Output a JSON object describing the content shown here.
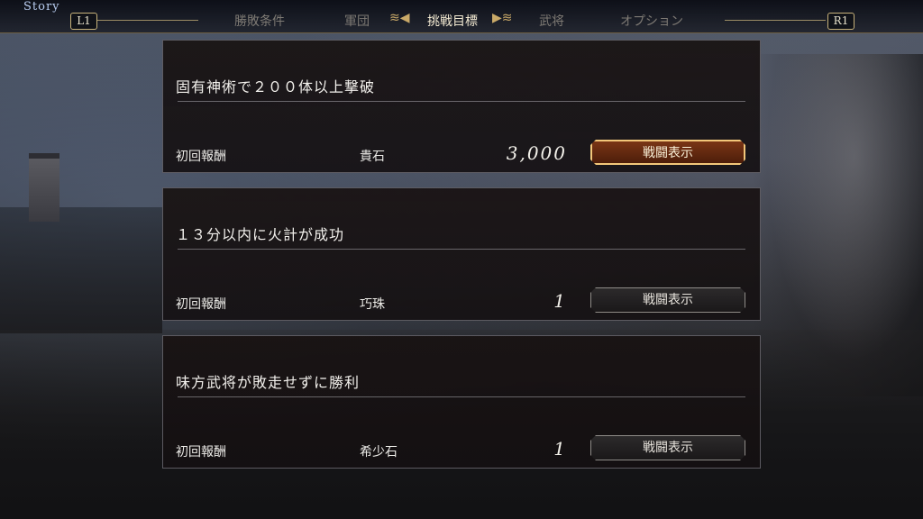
{
  "header": {
    "story_label": "Story",
    "left_bumper": "L1",
    "right_bumper": "R1",
    "tabs": [
      {
        "label": "勝敗条件",
        "active": false
      },
      {
        "label": "軍団",
        "active": false
      },
      {
        "label": "挑戦目標",
        "active": true
      },
      {
        "label": "武将",
        "active": false
      },
      {
        "label": "オプション",
        "active": false
      }
    ]
  },
  "challenges": [
    {
      "title": "固有神術で２００体以上撃破",
      "reward_label": "初回報酬",
      "reward_item": "貴石",
      "reward_qty": "3,000",
      "button_label": "戦闘表示",
      "selected": true
    },
    {
      "title": "１３分以内に火計が成功",
      "reward_label": "初回報酬",
      "reward_item": "巧珠",
      "reward_qty": "1",
      "button_label": "戦闘表示",
      "selected": false
    },
    {
      "title": "味方武将が敗走せずに勝利",
      "reward_label": "初回報酬",
      "reward_item": "希少石",
      "reward_qty": "1",
      "button_label": "戦闘表示",
      "selected": false
    }
  ],
  "colors": {
    "accent_gold": "#c9a968",
    "selected_button": "#7a3616",
    "active_tab_text": "#f3ead2",
    "inactive_tab_text": "#7e7a74"
  }
}
